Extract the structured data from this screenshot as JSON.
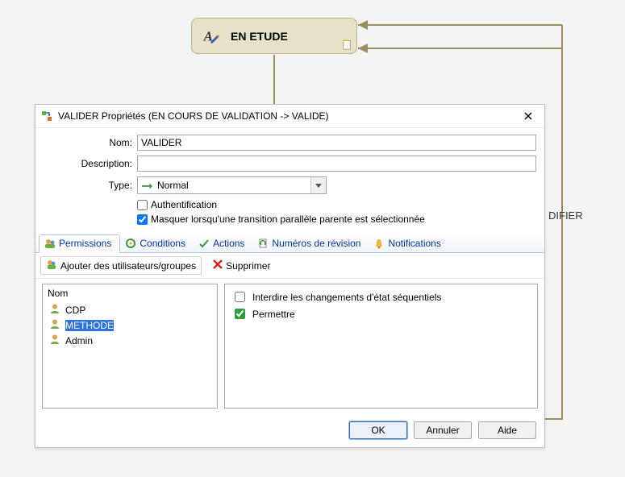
{
  "canvas": {
    "node_label": "EN ETUDE",
    "side_label": "DIFIER"
  },
  "dialog": {
    "title": "VALIDER Propriétés (EN COURS DE VALIDATION -> VALIDE)",
    "fields": {
      "nom_label": "Nom:",
      "nom_value": "VALIDER",
      "description_label": "Description:",
      "description_value": "",
      "type_label": "Type:",
      "type_value": "Normal",
      "auth_label": "Authentification",
      "auth_checked": false,
      "mask_label": "Masquer lorsqu'une transition parallèle parente est sélectionnée",
      "mask_checked": true
    },
    "tabs": {
      "permissions": "Permissions",
      "conditions": "Conditions",
      "actions": "Actions",
      "revisions": "Numéros de révision",
      "notifications": "Notifications"
    },
    "permissions": {
      "add_button": "Ajouter des utilisateurs/groupes",
      "delete_button": "Supprimer",
      "name_header": "Nom",
      "items": [
        {
          "label": "CDP",
          "kind": "user",
          "selected": false
        },
        {
          "label": "METHODE",
          "kind": "user",
          "selected": true
        },
        {
          "label": "Admin",
          "kind": "user",
          "selected": false
        }
      ],
      "options": {
        "interdire_label": "Interdire les changements d'état séquentiels",
        "interdire_checked": false,
        "permettre_label": "Permettre",
        "permettre_checked": true
      }
    },
    "buttons": {
      "ok": "OK",
      "cancel": "Annuler",
      "help": "Aide"
    }
  }
}
